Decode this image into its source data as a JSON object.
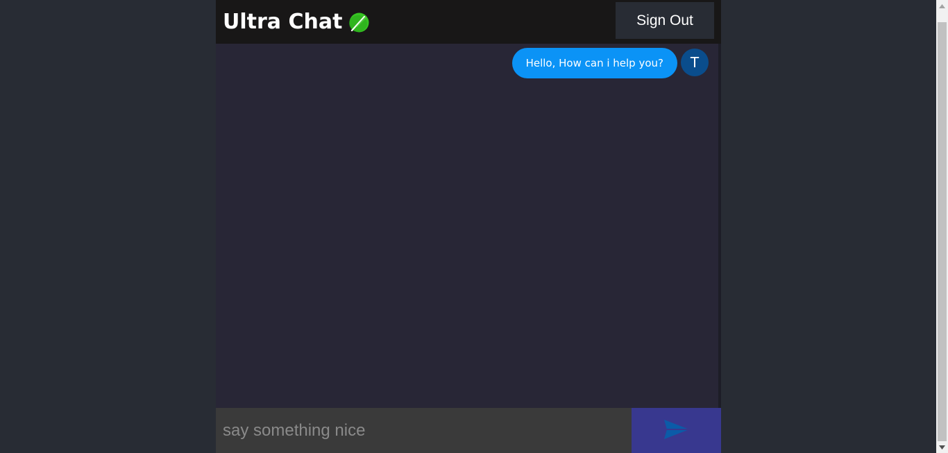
{
  "header": {
    "title": "Ultra Chat",
    "title_icon": "feather-icon",
    "signout_label": "Sign Out"
  },
  "messages": [
    {
      "text": "Hello, How can i help you?",
      "avatar_initial": "T",
      "direction": "sent"
    }
  ],
  "composer": {
    "placeholder": "say something nice",
    "value": "",
    "send_icon": "send-icon"
  },
  "colors": {
    "page_background": "#282c34",
    "header_background": "#181717",
    "chat_background": "#282636",
    "bubble": "#0b93f6",
    "avatar": "#0a4d8c",
    "send_button": "#38388f",
    "send_arrow": "#0b5ba8",
    "title_icon": "#37c423"
  }
}
